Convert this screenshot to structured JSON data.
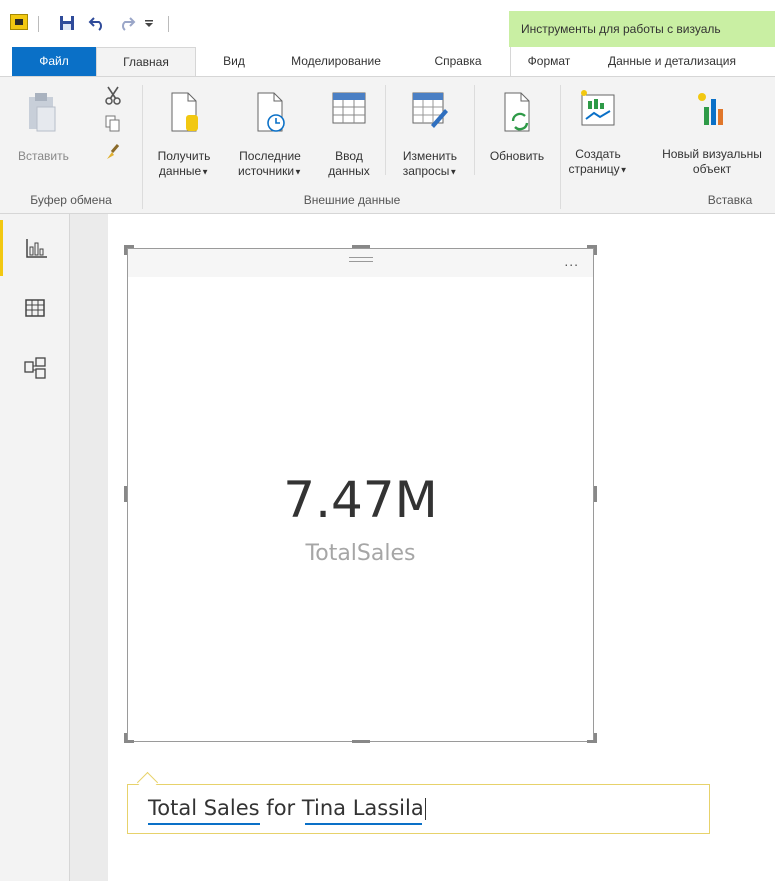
{
  "titlebar": {
    "context_tab_header": "Инструменты для работы с визуаль"
  },
  "tabs": [
    {
      "label": "Файл"
    },
    {
      "label": "Главная"
    },
    {
      "label": "Вид"
    },
    {
      "label": "Моделирование"
    },
    {
      "label": "Справка"
    },
    {
      "label": "Формат"
    },
    {
      "label": "Данные и детализация"
    }
  ],
  "ribbon": {
    "paste": "Вставить",
    "clipboard_group": "Буфер обмена",
    "get_data": [
      "Получить",
      "данные"
    ],
    "recent_sources": [
      "Последние",
      "источники"
    ],
    "enter_data": [
      "Ввод",
      "данных"
    ],
    "edit_queries": [
      "Изменить",
      "запросы"
    ],
    "refresh": "Обновить",
    "external_data_group": "Внешние данные",
    "new_page": [
      "Создать",
      "страницу"
    ],
    "new_visual": [
      "Новый визуальны",
      "объект"
    ],
    "insert_group": "Вставка"
  },
  "visual": {
    "value": "7.47M",
    "label": "TotalSales",
    "more": "..."
  },
  "qa": {
    "text_part1": "Total Sales",
    "text_part2": " for ",
    "text_part3": "Tina Lassila"
  },
  "colors": {
    "accent_blue": "#0a70c7",
    "context_green": "#c9efa3",
    "powerbi_yellow": "#f2c811"
  }
}
